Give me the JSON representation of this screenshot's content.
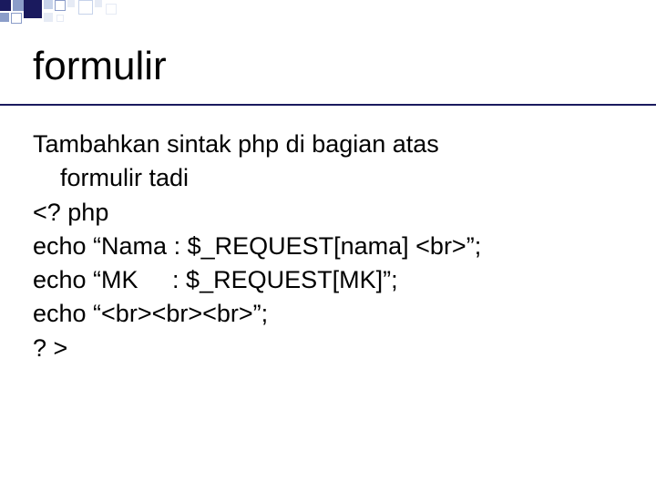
{
  "title": "formulir",
  "intro_line1": "Tambahkan sintak php di bagian atas",
  "intro_line2": "formulir tadi",
  "code": {
    "l1": "<? php",
    "l2": "echo “Nama : $_REQUEST[nama] <br>”;",
    "l3": "echo “MK     : $_REQUEST[MK]”;",
    "l4": "echo “<br><br><br>”;",
    "l5": "? >"
  },
  "deco": {
    "dark": "#1a1a5e",
    "mid": "#8b9dc9",
    "light": "#c7d3ea",
    "pale": "#e6ebf5"
  }
}
